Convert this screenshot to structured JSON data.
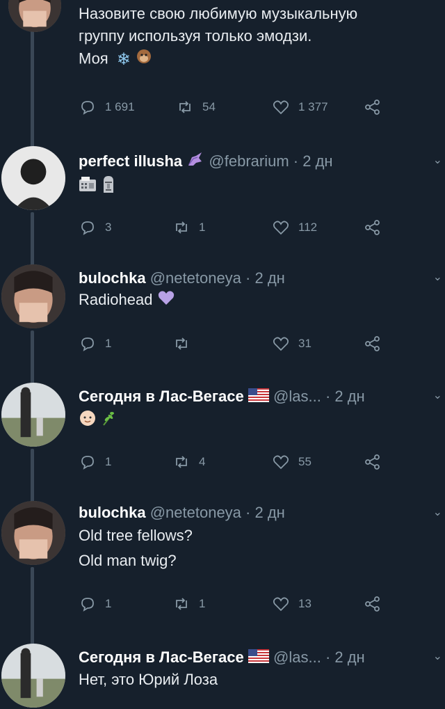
{
  "tweets": [
    {
      "text_lines": [
        "Назовите свою любимую музыкальную",
        "группу используя только эмодзи.",
        "Моя"
      ],
      "reply_count": "1 691",
      "retweet_count": "54",
      "like_count": "1 377"
    },
    {
      "name": "perfect illusha",
      "handle": "@febrarium",
      "time": "· 2 дн",
      "reply_count": "3",
      "retweet_count": "1",
      "like_count": "112"
    },
    {
      "name": "bulochka",
      "handle": "@netetoneya",
      "time": "· 2 дн",
      "text_lines": [
        "Radiohead"
      ],
      "reply_count": "1",
      "retweet_count": "",
      "like_count": "31"
    },
    {
      "name": "Сегодня в Лас-Вегасе",
      "handle": "@las...",
      "time": "· 2 дн",
      "reply_count": "1",
      "retweet_count": "4",
      "like_count": "55"
    },
    {
      "name": "bulochka",
      "handle": "@netetoneya",
      "time": "· 2 дн",
      "text_lines": [
        "Old tree fellows?",
        "Old man twig?"
      ],
      "reply_count": "1",
      "retweet_count": "1",
      "like_count": "13"
    },
    {
      "name": "Сегодня в Лас-Вегасе",
      "handle": "@las...",
      "time": "· 2 дн",
      "text_lines": [
        "Нет, это Юрий Лоза"
      ]
    }
  ],
  "colors": {
    "background": "#16202c",
    "secondary_text": "#8899a6",
    "thread_line": "#3a4756",
    "heart_purple": "#b8a2e6"
  }
}
